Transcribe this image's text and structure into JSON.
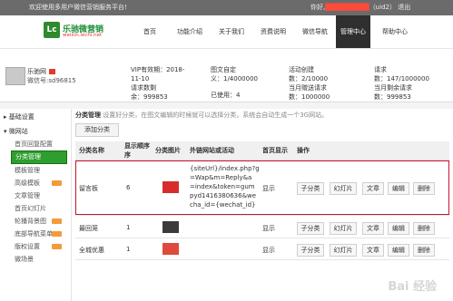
{
  "topbar": {
    "welcome": "欢迎使用多用户微信营销服务平台!",
    "user_prefix": "你好,",
    "username": "█████████",
    "uid": "（uid2）",
    "logout": "退出"
  },
  "logo": {
    "badge": "Lc",
    "name": "乐驰微营销",
    "site": "weixin.lechi.net"
  },
  "nav": {
    "items": [
      "首页",
      "功能介绍",
      "关于我们",
      "资费说明",
      "微信导航",
      "管理中心",
      "帮助中心"
    ],
    "active_index": 5
  },
  "account": {
    "name": "乐驰网",
    "wechat_id": "微信号:sd96815"
  },
  "stats": {
    "vip_label": "VIP有效期：2018-",
    "vip_date_cont": "11-10",
    "requests_label": "请求数剩",
    "requests_remaining": "余：999853",
    "custom_pics_label": "图文自定",
    "custom_pics_value": "义：1/4000000",
    "used_label": "已使用：4",
    "activities_label": "活动创建",
    "activities_value": "数：2/10000",
    "monthly_pics_label": "当月赠送请求",
    "monthly_pics_value": "数：1000000",
    "req_label": "请求",
    "req_value": "数：147/1000000",
    "month_remain_label": "当月剩余请求",
    "month_remain_value": "数：999853"
  },
  "sidebar": {
    "groups": [
      {
        "label": "基础设置",
        "expanded": false
      },
      {
        "label": "微网站",
        "expanded": true
      }
    ],
    "items": [
      {
        "label": "首页回复配置",
        "new": false
      },
      {
        "label": "分类管理",
        "new": false,
        "active": true
      },
      {
        "label": "模板管理",
        "new": false
      },
      {
        "label": "高级模板",
        "new": true
      },
      {
        "label": "文章管理",
        "new": false
      },
      {
        "label": "首页幻灯片",
        "new": false
      },
      {
        "label": "轮播背景图",
        "new": true
      },
      {
        "label": "底部导航菜单",
        "new": true
      },
      {
        "label": "版权设置",
        "new": true
      },
      {
        "label": "微场景",
        "new": false
      }
    ]
  },
  "main": {
    "crumb_title": "分类管理",
    "crumb_desc": "设置好分类，在图文编辑的时候就可以选择分类，系统会自动生成一个3G网站。",
    "add_button": "添加分类",
    "columns": [
      "分类名称",
      "显示顺序",
      "分类图片",
      "外链网站或活动",
      "首页显示",
      "操作"
    ],
    "column_sub": [
      "",
      "序",
      "",
      "",
      "",
      ""
    ],
    "rows": [
      {
        "name": "留言板",
        "order": "6",
        "thumb_color": "#d82c2c",
        "url_lines": [
          "{siteUrl}/index.php?g",
          "=Wap&m=Reply&a",
          "=index&token=gum",
          "pyd1416380636&we",
          "cha_id={wechat_id}"
        ],
        "display": "显示",
        "ops": [
          "子分类",
          "幻灯片",
          "文章",
          "编辑",
          "删除"
        ]
      },
      {
        "name": "最回笼",
        "order": "1",
        "thumb_color": "#3a3a3a",
        "url_lines": [],
        "display": "显示",
        "ops": [
          "子分类",
          "幻灯片",
          "文章",
          "编辑",
          "删除"
        ]
      },
      {
        "name": "全城优惠",
        "order": "1",
        "thumb_color": "#e04a3a",
        "url_lines": [],
        "display": "显示",
        "ops": [
          "子分类",
          "幻灯片",
          "文章",
          "编辑",
          "删除"
        ]
      }
    ]
  },
  "watermark": "Bai 经验"
}
